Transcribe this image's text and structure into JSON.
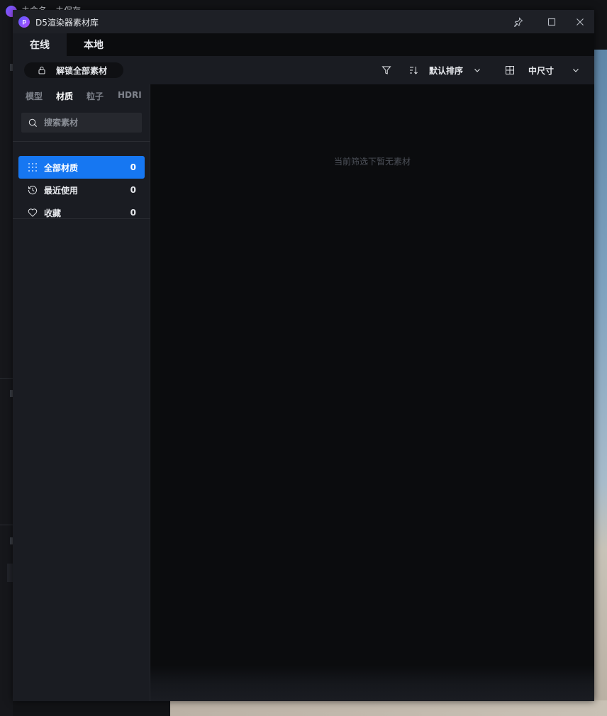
{
  "host": {
    "title": "未命名 - 未保存"
  },
  "dialog": {
    "title": "D5渲染器素材库",
    "tabs": [
      {
        "label": "在线",
        "active": true
      },
      {
        "label": "本地",
        "active": false
      }
    ],
    "toolbar": {
      "unlock_label": "解锁全部素材",
      "sort_label": "默认排序",
      "size_label": "中尺寸"
    },
    "sidebar": {
      "categories": [
        {
          "label": "模型",
          "active": false
        },
        {
          "label": "材质",
          "active": true
        },
        {
          "label": "粒子",
          "active": false
        },
        {
          "label": "HDRI",
          "active": false
        }
      ],
      "search_placeholder": "搜索素材",
      "items": [
        {
          "label": "全部材质",
          "count": "0",
          "active": true,
          "icon": "grid-dots-icon"
        },
        {
          "label": "最近使用",
          "count": "0",
          "active": false,
          "icon": "history-icon"
        },
        {
          "label": "收藏",
          "count": "0",
          "active": false,
          "icon": "heart-icon"
        }
      ]
    },
    "main": {
      "empty_message": "当前筛选下暂无素材"
    }
  },
  "colors": {
    "accent": "#1677f2",
    "background": "#0b0c0e",
    "panel": "#1a1c22"
  }
}
